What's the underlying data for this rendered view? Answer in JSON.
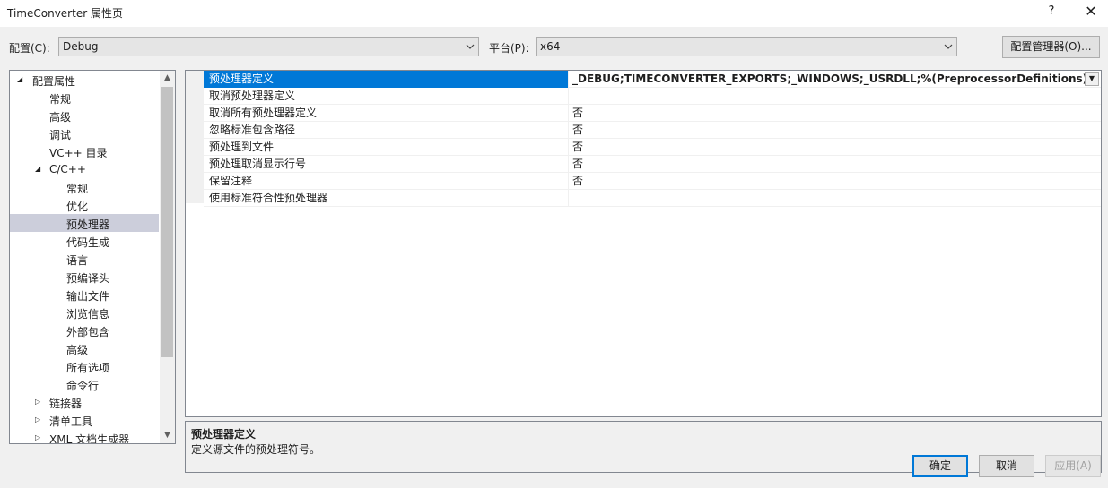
{
  "window": {
    "title": "TimeConverter 属性页",
    "help_glyph": "?",
    "close_glyph": "✕"
  },
  "config_bar": {
    "config_label": "配置(C):",
    "config_value": "Debug",
    "platform_label": "平台(P):",
    "platform_value": "x64",
    "manager_button": "配置管理器(O)..."
  },
  "tree": {
    "items": [
      {
        "label": "配置属性",
        "expander": "◢",
        "selected": false
      },
      {
        "label": "常规",
        "expander": "",
        "selected": false
      },
      {
        "label": "高级",
        "expander": "",
        "selected": false
      },
      {
        "label": "调试",
        "expander": "",
        "selected": false
      },
      {
        "label": "VC++ 目录",
        "expander": "",
        "selected": false
      },
      {
        "label": "C/C++",
        "expander": "◢",
        "selected": false
      },
      {
        "label": "常规",
        "expander": "",
        "selected": false
      },
      {
        "label": "优化",
        "expander": "",
        "selected": false
      },
      {
        "label": "预处理器",
        "expander": "",
        "selected": true
      },
      {
        "label": "代码生成",
        "expander": "",
        "selected": false
      },
      {
        "label": "语言",
        "expander": "",
        "selected": false
      },
      {
        "label": "预编译头",
        "expander": "",
        "selected": false
      },
      {
        "label": "输出文件",
        "expander": "",
        "selected": false
      },
      {
        "label": "浏览信息",
        "expander": "",
        "selected": false
      },
      {
        "label": "外部包含",
        "expander": "",
        "selected": false
      },
      {
        "label": "高级",
        "expander": "",
        "selected": false
      },
      {
        "label": "所有选项",
        "expander": "",
        "selected": false
      },
      {
        "label": "命令行",
        "expander": "",
        "selected": false
      },
      {
        "label": "链接器",
        "expander": "▷",
        "selected": false
      },
      {
        "label": "清单工具",
        "expander": "▷",
        "selected": false
      },
      {
        "label": "XML 文档生成器",
        "expander": "▷",
        "selected": false
      }
    ],
    "scroll_up": "▲",
    "scroll_down": "▼"
  },
  "properties": {
    "rows": [
      {
        "name": "预处理器定义",
        "value": "_DEBUG;TIMECONVERTER_EXPORTS;_WINDOWS;_USRDLL;%(PreprocessorDefinitions)",
        "selected": true
      },
      {
        "name": "取消预处理器定义",
        "value": "",
        "selected": false
      },
      {
        "name": "取消所有预处理器定义",
        "value": "否",
        "selected": false
      },
      {
        "name": "忽略标准包含路径",
        "value": "否",
        "selected": false
      },
      {
        "name": "预处理到文件",
        "value": "否",
        "selected": false
      },
      {
        "name": "预处理取消显示行号",
        "value": "否",
        "selected": false
      },
      {
        "name": "保留注释",
        "value": "否",
        "selected": false
      },
      {
        "name": "使用标准符合性预处理器",
        "value": "",
        "selected": false
      }
    ],
    "dropdown_glyph": "▼"
  },
  "description": {
    "title": "预处理器定义",
    "text": "定义源文件的预处理符号。"
  },
  "buttons": {
    "ok": "确定",
    "cancel": "取消",
    "apply": "应用(A)"
  }
}
